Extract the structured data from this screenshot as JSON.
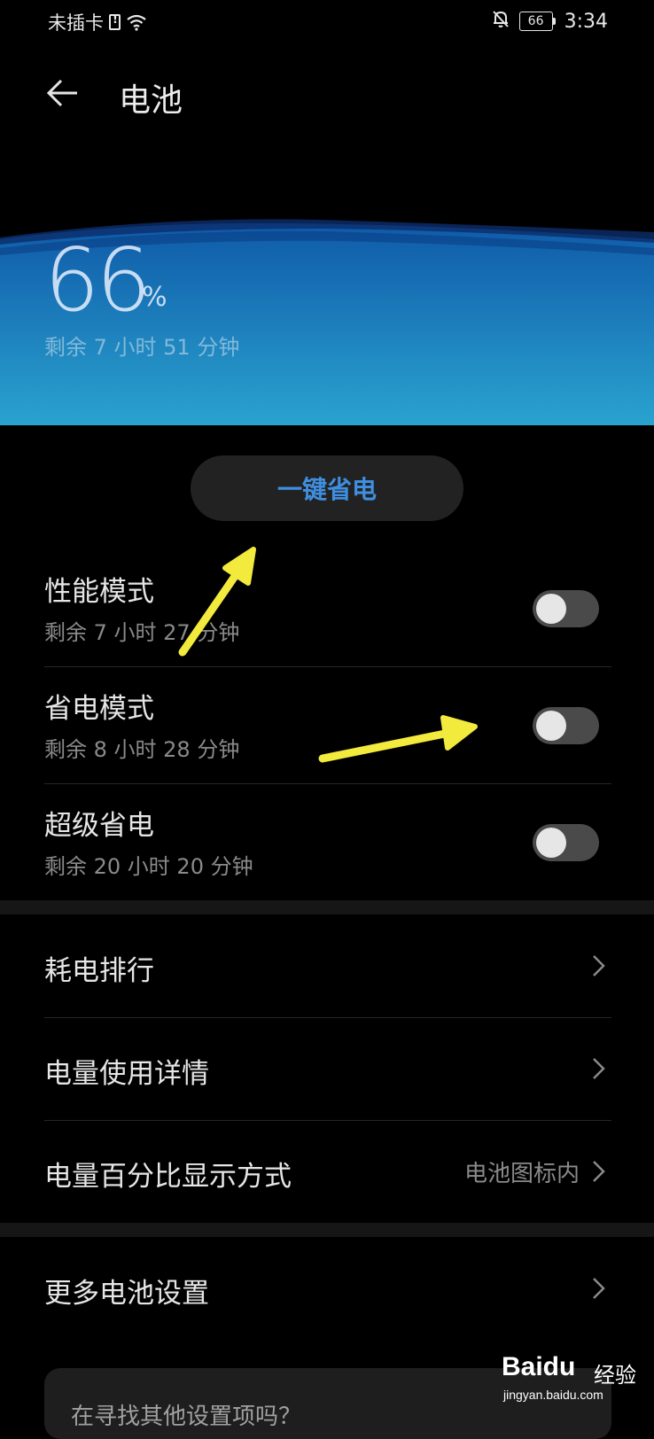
{
  "status_bar": {
    "carrier": "未插卡",
    "battery_level": "66",
    "time": "3:34"
  },
  "header": {
    "title": "电池"
  },
  "battery": {
    "percent": "66",
    "percent_sign": "%",
    "remaining": "剩余 7 小时 51 分钟"
  },
  "onekey": {
    "label": "一键省电"
  },
  "modes": [
    {
      "title": "性能模式",
      "sub": "剩余 7 小时 27 分钟",
      "enabled": false
    },
    {
      "title": "省电模式",
      "sub": "剩余 8 小时 28 分钟",
      "enabled": false
    },
    {
      "title": "超级省电",
      "sub": "剩余 20 小时 20 分钟",
      "enabled": false
    }
  ],
  "list": [
    {
      "label": "耗电排行"
    },
    {
      "label": "电量使用详情"
    },
    {
      "label": "电量百分比显示方式",
      "value": "电池图标内"
    },
    {
      "label": "更多电池设置"
    }
  ],
  "search_card": {
    "text": "在寻找其他设置项吗？"
  },
  "watermark": {
    "brand": "Baidu",
    "sub": "经验",
    "url": "jingyan.baidu.com"
  },
  "colors": {
    "accent": "#3f8fe0",
    "arrow": "#f2ea3c",
    "background": "#000000"
  }
}
